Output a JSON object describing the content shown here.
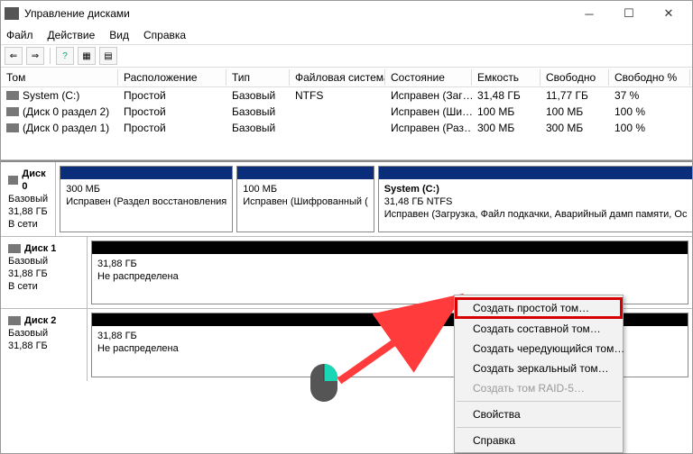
{
  "title": "Управление дисками",
  "menu": {
    "file": "Файл",
    "action": "Действие",
    "view": "Вид",
    "help": "Справка"
  },
  "vol_headers": {
    "tom": "Том",
    "ras": "Расположение",
    "tip": "Тип",
    "fs": "Файловая система",
    "state": "Состояние",
    "cap": "Емкость",
    "free": "Свободно",
    "pct": "Свободно %"
  },
  "volumes": [
    {
      "tom": "System (C:)",
      "ras": "Простой",
      "tip": "Базовый",
      "fs": "NTFS",
      "state": "Исправен (Заг…",
      "cap": "31,48 ГБ",
      "free": "11,77 ГБ",
      "pct": "37 %"
    },
    {
      "tom": "(Диск 0 раздел 2)",
      "ras": "Простой",
      "tip": "Базовый",
      "fs": "",
      "state": "Исправен (Ши…",
      "cap": "100 МБ",
      "free": "100 МБ",
      "pct": "100 %"
    },
    {
      "tom": "(Диск 0 раздел 1)",
      "ras": "Простой",
      "tip": "Базовый",
      "fs": "",
      "state": "Исправен (Раз…",
      "cap": "300 МБ",
      "free": "300 МБ",
      "pct": "100 %"
    }
  ],
  "disks": [
    {
      "name": "Диск 0",
      "type": "Базовый",
      "size": "31,88 ГБ",
      "status": "В сети",
      "parts": [
        {
          "stripe": "blue",
          "title": "",
          "line1": "300 МБ",
          "line2": "Исправен (Раздел восстановления"
        },
        {
          "stripe": "blue",
          "title": "",
          "line1": "100 МБ",
          "line2": "Исправен (Шифрованный ("
        },
        {
          "stripe": "blue",
          "title": "System  (C:)",
          "line1": "31,48 ГБ NTFS",
          "line2": "Исправен (Загрузка, Файл подкачки, Аварийный дамп памяти, Ос"
        }
      ]
    },
    {
      "name": "Диск 1",
      "type": "Базовый",
      "size": "31,88 ГБ",
      "status": "В сети",
      "parts": [
        {
          "stripe": "black",
          "title": "",
          "line1": "31,88 ГБ",
          "line2": "Не распределена"
        }
      ]
    },
    {
      "name": "Диск 2",
      "type": "Базовый",
      "size": "31,88 ГБ",
      "status": "",
      "parts": [
        {
          "stripe": "black",
          "title": "",
          "line1": "31,88 ГБ",
          "line2": "Не распределена"
        }
      ]
    }
  ],
  "context_menu": {
    "simple": "Создать простой том…",
    "spanned": "Создать составной том…",
    "striped": "Создать чередующийся том…",
    "mirror": "Создать зеркальный том…",
    "raid5": "Создать том RAID-5…",
    "props": "Свойства",
    "help": "Справка"
  }
}
